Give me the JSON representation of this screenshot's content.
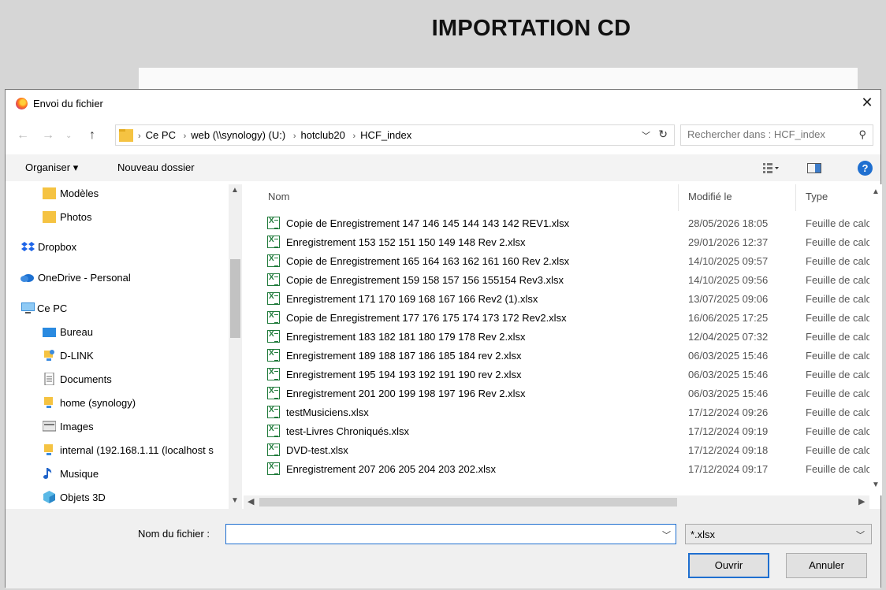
{
  "page": {
    "title": "IMPORTATION CD"
  },
  "dialog": {
    "title": "Envoi du fichier",
    "close_label": "✕",
    "address": {
      "crumbs": [
        "Ce PC",
        "web (\\\\synology) (U:)",
        "hotclub20",
        "HCF_index"
      ]
    },
    "search": {
      "placeholder": "Rechercher dans : HCF_index"
    },
    "toolbar": {
      "organize": "Organiser ▾",
      "new_folder": "Nouveau dossier"
    },
    "nav_items": [
      {
        "label": "Modèles",
        "icon": "folder-icon"
      },
      {
        "label": "Photos",
        "icon": "folder-icon"
      },
      {
        "label": "Dropbox",
        "icon": "dropbox-icon"
      },
      {
        "label": "OneDrive - Personal",
        "icon": "onedrive-icon"
      },
      {
        "label": "Ce PC",
        "icon": "computer-icon"
      },
      {
        "label": "Bureau",
        "icon": "desktop-icon"
      },
      {
        "label": "D-LINK",
        "icon": "network-drive-icon"
      },
      {
        "label": "Documents",
        "icon": "documents-icon"
      },
      {
        "label": "home (synology)",
        "icon": "network-drive-icon"
      },
      {
        "label": "Images",
        "icon": "images-icon"
      },
      {
        "label": "internal (192.168.1.11 (localhost s",
        "icon": "network-drive-icon"
      },
      {
        "label": "Musique",
        "icon": "music-icon"
      },
      {
        "label": "Objets 3D",
        "icon": "objects-3d-icon"
      }
    ],
    "columns": {
      "name": "Nom",
      "modified": "Modifié le",
      "type": "Type"
    },
    "files": [
      {
        "name": "Copie de Enregistrement 147 146 145 144 143 142 REV1.xlsx",
        "date": "28/05/2026 18:05",
        "type": "Feuille de calc"
      },
      {
        "name": "Enregistrement 153 152 151 150 149 148 Rev 2.xlsx",
        "date": "29/01/2026 12:37",
        "type": "Feuille de calc"
      },
      {
        "name": "Copie de Enregistrement 165 164 163 162 161 160 Rev 2.xlsx",
        "date": "14/10/2025 09:57",
        "type": "Feuille de calc"
      },
      {
        "name": "Copie de Enregistrement 159 158 157 156 155154 Rev3.xlsx",
        "date": "14/10/2025 09:56",
        "type": "Feuille de calc"
      },
      {
        "name": "Enregistrement 171 170 169 168 167 166 Rev2 (1).xlsx",
        "date": "13/07/2025 09:06",
        "type": "Feuille de calc"
      },
      {
        "name": "Copie de Enregistrement 177 176 175 174 173 172 Rev2.xlsx",
        "date": "16/06/2025 17:25",
        "type": "Feuille de calc"
      },
      {
        "name": "Enregistrement 183 182 181 180 179 178 Rev 2.xlsx",
        "date": "12/04/2025 07:32",
        "type": "Feuille de calc"
      },
      {
        "name": "Enregistrement 189 188 187 186 185 184 rev 2.xlsx",
        "date": "06/03/2025 15:46",
        "type": "Feuille de calc"
      },
      {
        "name": "Enregistrement 195 194 193 192 191 190 rev 2.xlsx",
        "date": "06/03/2025 15:46",
        "type": "Feuille de calc"
      },
      {
        "name": "Enregistrement 201 200 199 198 197 196 Rev 2.xlsx",
        "date": "06/03/2025 15:46",
        "type": "Feuille de calc"
      },
      {
        "name": "testMusiciens.xlsx",
        "date": "17/12/2024 09:26",
        "type": "Feuille de calc"
      },
      {
        "name": "test-Livres Chroniqués.xlsx",
        "date": "17/12/2024 09:19",
        "type": "Feuille de calc"
      },
      {
        "name": "DVD-test.xlsx",
        "date": "17/12/2024 09:18",
        "type": "Feuille de calc"
      },
      {
        "name": "Enregistrement 207 206 205 204 203 202.xlsx",
        "date": "17/12/2024 09:17",
        "type": "Feuille de calc"
      }
    ],
    "filename_label": "Nom du fichier :",
    "filename_value": "",
    "filter_value": "*.xlsx",
    "open_button": "Ouvrir",
    "cancel_button": "Annuler"
  }
}
